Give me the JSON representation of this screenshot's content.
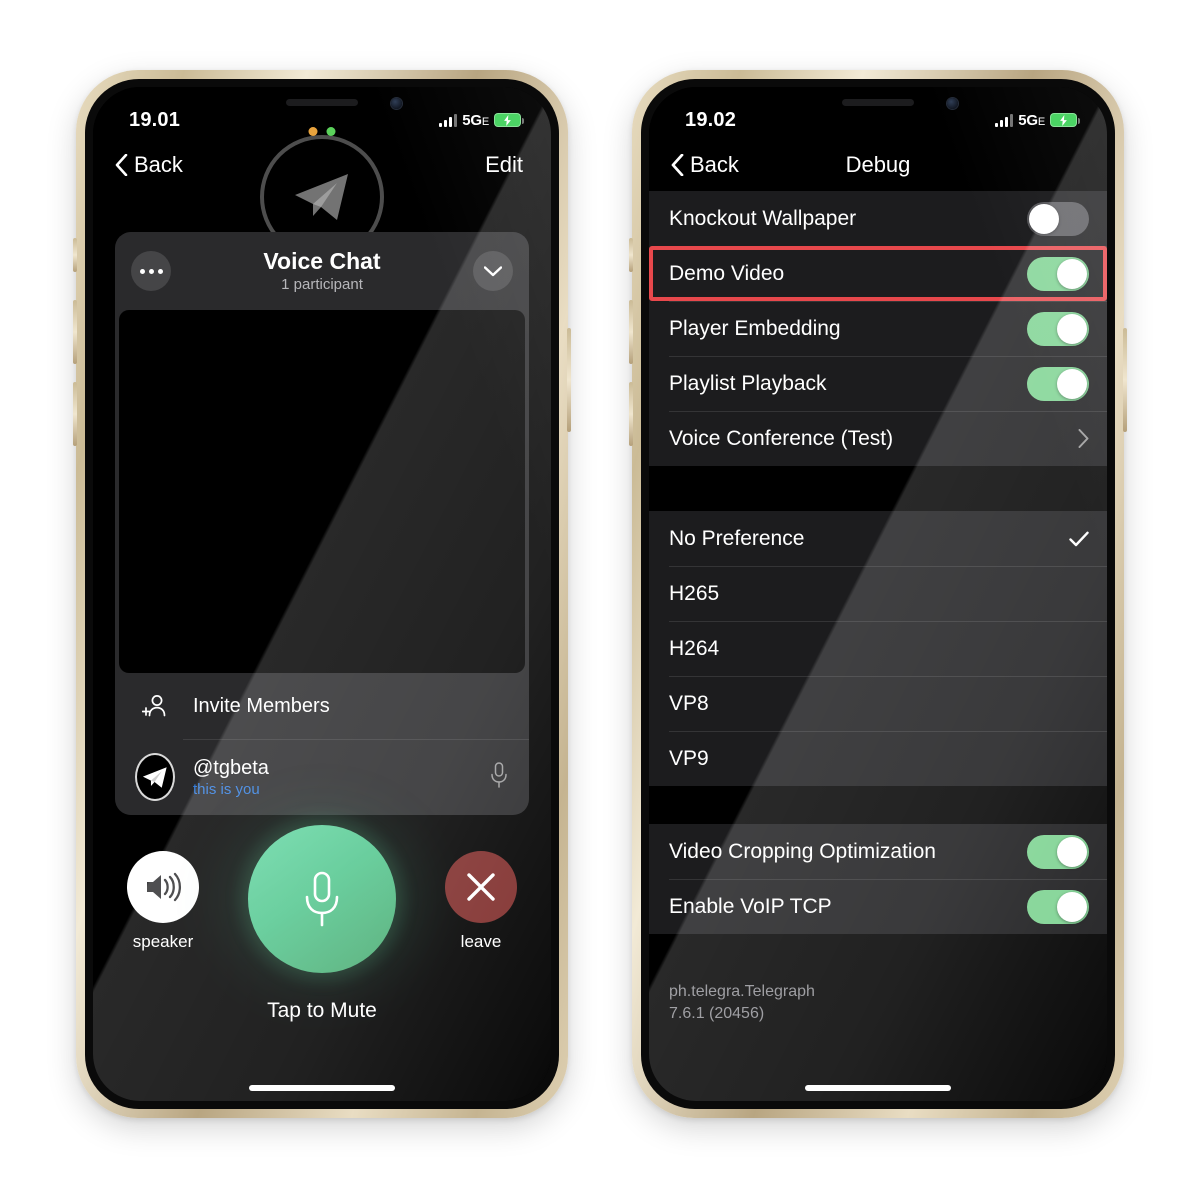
{
  "left_phone": {
    "status_bar": {
      "time": "19.01",
      "network": "5G",
      "network_suffix": "E",
      "battery_state": "charging"
    },
    "nav": {
      "back_label": "Back",
      "edit_label": "Edit"
    },
    "voice_chat": {
      "title": "Voice Chat",
      "subtitle": "1 participant",
      "more_icon": "ellipsis-icon",
      "collapse_icon": "chevron-down-icon",
      "invite_label": "Invite Members",
      "invite_icon": "person-add-icon",
      "member": {
        "name": "@tgbeta",
        "status": "this is you",
        "avatar_icon": "telegram-plane-icon",
        "mic_icon": "microphone-icon"
      }
    },
    "controls": {
      "speaker_label": "speaker",
      "speaker_icon": "speaker-wave-icon",
      "mute_label": "Tap to Mute",
      "mute_icon": "microphone-icon",
      "leave_label": "leave",
      "leave_icon": "close-x-icon"
    },
    "colors": {
      "mute_green": "#53c78f",
      "leave_red": "#7f2d2b",
      "link_blue": "#347fe0"
    }
  },
  "right_phone": {
    "status_bar": {
      "time": "19.02",
      "network": "5G",
      "network_suffix": "E",
      "battery_state": "charging"
    },
    "nav": {
      "back_label": "Back",
      "title": "Debug"
    },
    "sections": [
      {
        "rows": [
          {
            "label": "Knockout Wallpaper",
            "control": "toggle",
            "value": "off",
            "highlighted": false
          },
          {
            "label": "Demo Video",
            "control": "toggle",
            "value": "on",
            "highlighted": true
          },
          {
            "label": "Player Embedding",
            "control": "toggle",
            "value": "on",
            "highlighted": false
          },
          {
            "label": "Playlist Playback",
            "control": "toggle",
            "value": "on",
            "highlighted": false
          },
          {
            "label": "Voice Conference (Test)",
            "control": "disclosure",
            "value": "",
            "highlighted": false
          }
        ]
      },
      {
        "rows": [
          {
            "label": "No Preference",
            "control": "checkmark",
            "value": "selected",
            "highlighted": false
          },
          {
            "label": "H265",
            "control": "none",
            "value": "",
            "highlighted": false
          },
          {
            "label": "H264",
            "control": "none",
            "value": "",
            "highlighted": false
          },
          {
            "label": "VP8",
            "control": "none",
            "value": "",
            "highlighted": false
          },
          {
            "label": "VP9",
            "control": "none",
            "value": "",
            "highlighted": false
          }
        ]
      },
      {
        "rows": [
          {
            "label": "Video Cropping Optimization",
            "control": "toggle",
            "value": "on",
            "highlighted": false
          },
          {
            "label": "Enable VoIP TCP",
            "control": "toggle",
            "value": "on",
            "highlighted": false
          }
        ]
      }
    ],
    "footer": {
      "bundle_id": "ph.telegra.Telegraph",
      "version": "7.6.1 (20456)"
    },
    "colors": {
      "toggle_on": "#7ed392",
      "toggle_off": "#5b5b5f",
      "highlight": "#e8484c"
    }
  }
}
